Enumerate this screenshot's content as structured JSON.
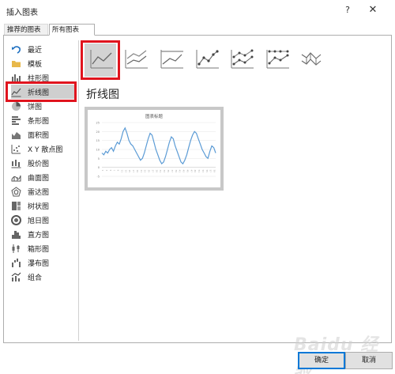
{
  "window": {
    "title": "插入图表",
    "help_label": "?",
    "close_label": "✕"
  },
  "tabs": [
    {
      "label": "推荐的图表",
      "active": false
    },
    {
      "label": "所有图表",
      "active": true
    }
  ],
  "sidebar": {
    "items": [
      {
        "label": "最近",
        "icon": "undo-icon"
      },
      {
        "label": "模板",
        "icon": "folder-icon"
      },
      {
        "label": "柱形图",
        "icon": "column-chart-icon"
      },
      {
        "label": "折线图",
        "icon": "line-chart-icon",
        "selected": true
      },
      {
        "label": "饼图",
        "icon": "pie-chart-icon"
      },
      {
        "label": "条形图",
        "icon": "bar-chart-icon"
      },
      {
        "label": "面积图",
        "icon": "area-chart-icon"
      },
      {
        "label": "X Y 散点图",
        "icon": "scatter-chart-icon"
      },
      {
        "label": "股价图",
        "icon": "stock-chart-icon"
      },
      {
        "label": "曲面图",
        "icon": "surface-chart-icon"
      },
      {
        "label": "雷达图",
        "icon": "radar-chart-icon"
      },
      {
        "label": "树状图",
        "icon": "treemap-chart-icon"
      },
      {
        "label": "旭日图",
        "icon": "sunburst-chart-icon"
      },
      {
        "label": "直方图",
        "icon": "histogram-chart-icon"
      },
      {
        "label": "箱形图",
        "icon": "box-whisker-chart-icon"
      },
      {
        "label": "瀑布图",
        "icon": "waterfall-chart-icon"
      },
      {
        "label": "组合",
        "icon": "combo-chart-icon"
      }
    ]
  },
  "subtypes": [
    {
      "name": "line",
      "icon": "line-chart-icon",
      "selected": true
    },
    {
      "name": "stacked-line",
      "icon": "stacked-line-icon"
    },
    {
      "name": "100-stacked-line",
      "icon": "percent-stacked-line-icon"
    },
    {
      "name": "line-with-markers",
      "icon": "line-markers-icon"
    },
    {
      "name": "stacked-line-with-markers",
      "icon": "stacked-line-markers-icon"
    },
    {
      "name": "100-stacked-line-with-markers",
      "icon": "percent-stacked-line-markers-icon"
    },
    {
      "name": "3d-line",
      "icon": "3d-line-icon"
    }
  ],
  "main": {
    "heading": "折线图"
  },
  "preview": {
    "title": "图表标题",
    "line_color": "#5b9bd5",
    "y_ticks": [
      "25",
      "20",
      "15",
      "10",
      "5",
      "0",
      "-5"
    ]
  },
  "chart_data": {
    "type": "line",
    "title": "图表标题",
    "ylim": [
      -5,
      25
    ],
    "x": [
      1,
      2,
      3,
      4,
      5,
      6,
      7,
      8,
      9,
      10,
      11,
      12,
      13,
      14,
      15,
      16,
      17,
      18,
      19,
      20,
      21,
      22,
      23,
      24,
      25,
      26,
      27,
      28,
      29,
      30,
      31,
      32,
      33,
      34,
      35,
      36,
      37,
      38,
      39,
      40,
      41,
      42,
      43,
      44,
      45,
      46,
      47,
      48,
      49,
      50,
      51,
      52,
      53,
      54,
      55,
      56,
      57,
      58,
      59,
      60
    ],
    "series": [
      {
        "values": [
          8,
          7,
          9,
          8,
          10,
          11,
          9,
          12,
          14,
          13,
          16,
          20,
          22,
          19,
          15,
          13,
          12,
          10,
          8,
          6,
          4,
          5,
          8,
          12,
          16,
          19,
          18,
          14,
          10,
          7,
          4,
          2,
          3,
          6,
          10,
          14,
          17,
          16,
          12,
          9,
          6,
          3,
          2,
          4,
          7,
          11,
          15,
          18,
          20,
          19,
          16,
          13,
          10,
          8,
          6,
          5,
          9,
          12,
          11,
          8
        ]
      }
    ]
  },
  "footer": {
    "ok_label": "确定",
    "cancel_label": "取消"
  },
  "watermark": "Baidu 经验"
}
